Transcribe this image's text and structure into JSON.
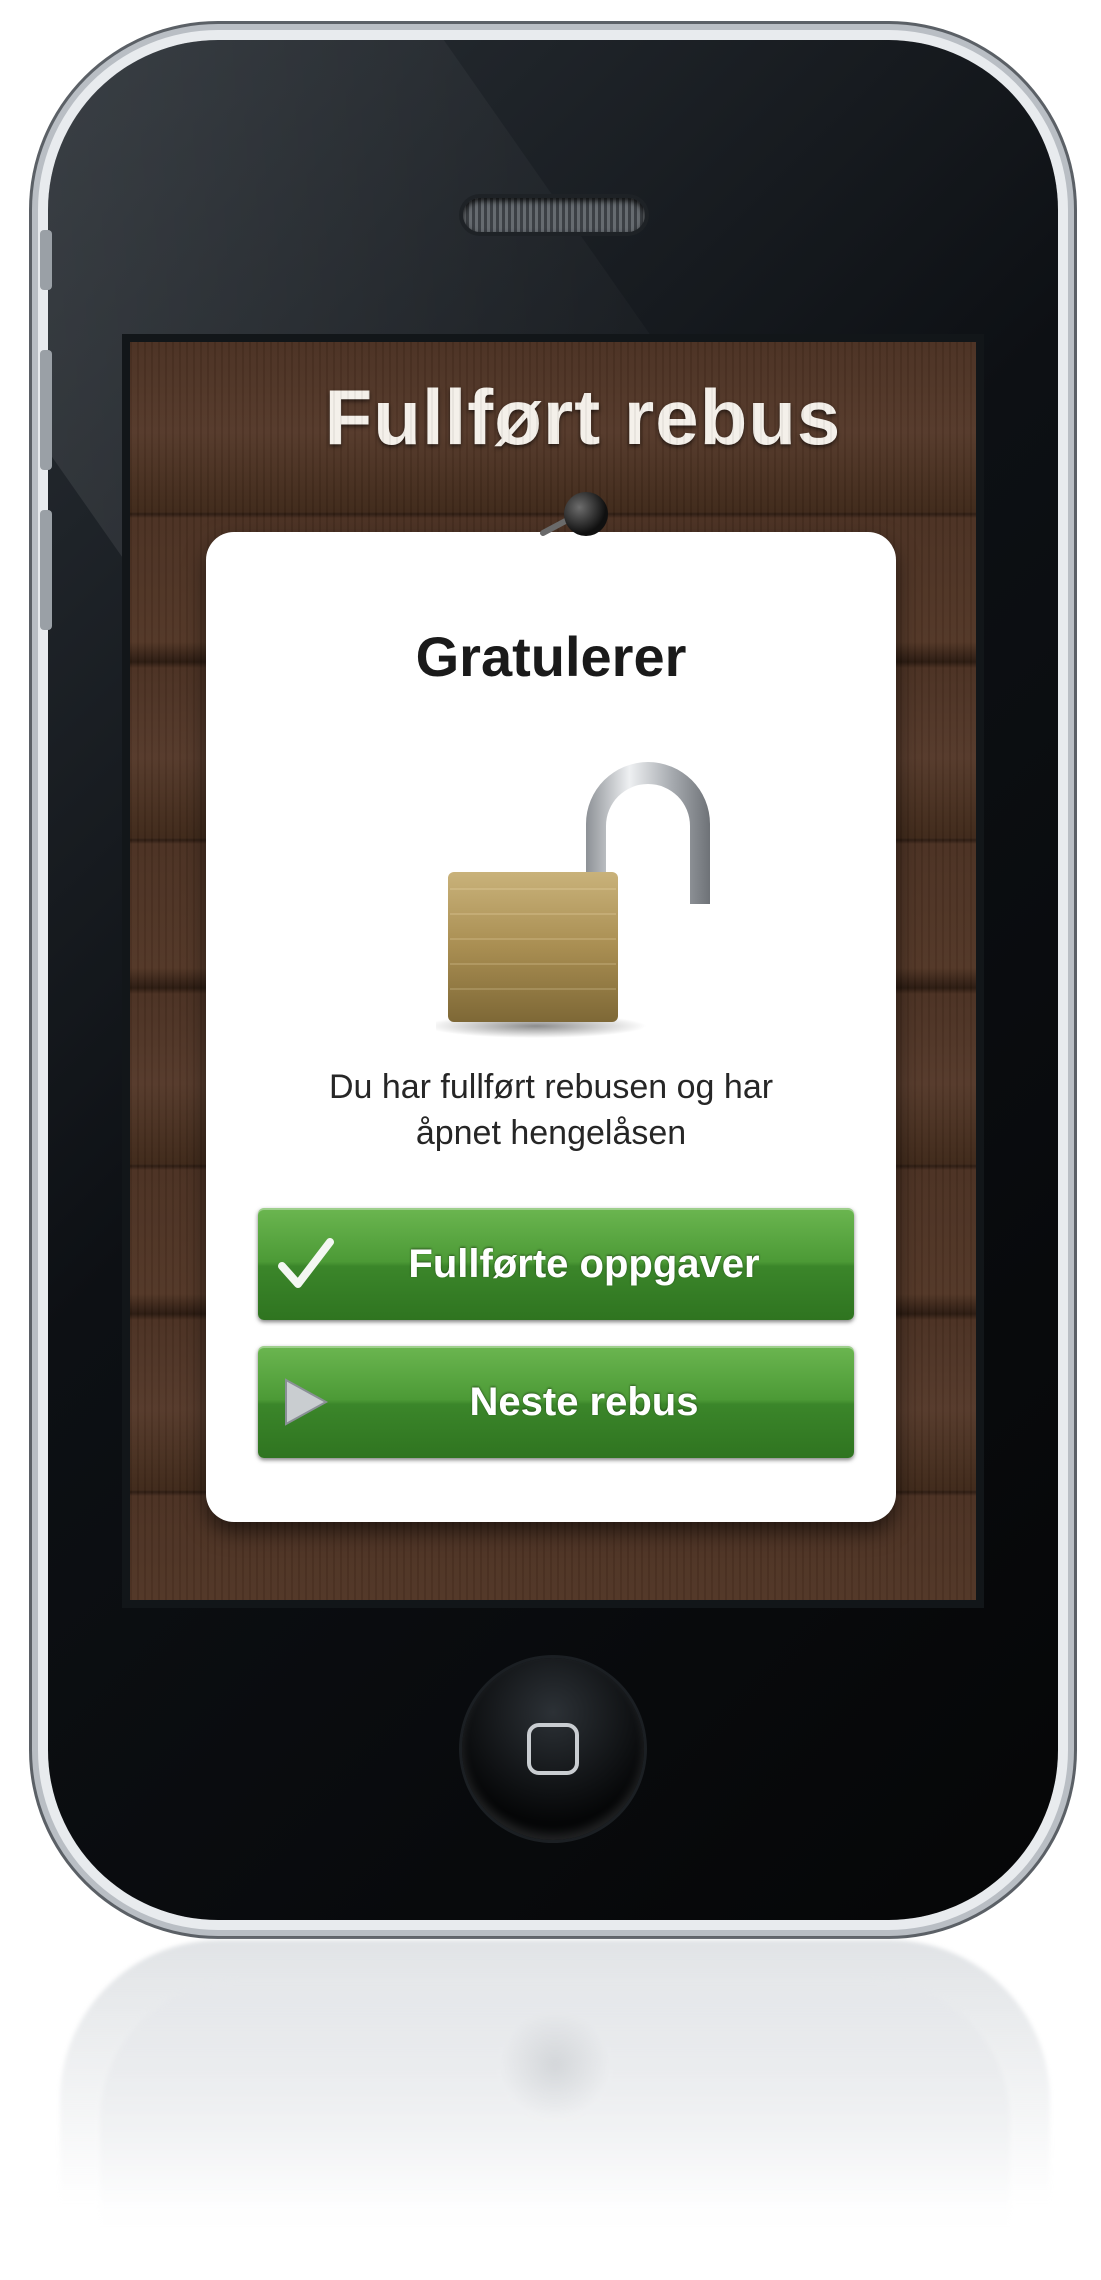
{
  "screen": {
    "title": "Fullført rebus",
    "card": {
      "heading": "Gratulerer",
      "message_line1": "Du har fullført rebusen og har",
      "message_line2": "åpnet hengelåsen",
      "lock_icon": "open-padlock-icon"
    },
    "buttons": [
      {
        "label": "Fullførte oppgaver",
        "icon": "checkmark-icon"
      },
      {
        "label": "Neste rebus",
        "icon": "play-arrow-icon"
      }
    ]
  },
  "colors": {
    "button_green": "#4c9a36",
    "wood_brown": "#4a3022",
    "card_white": "#ffffff",
    "title_text": "#f4f0ea"
  }
}
